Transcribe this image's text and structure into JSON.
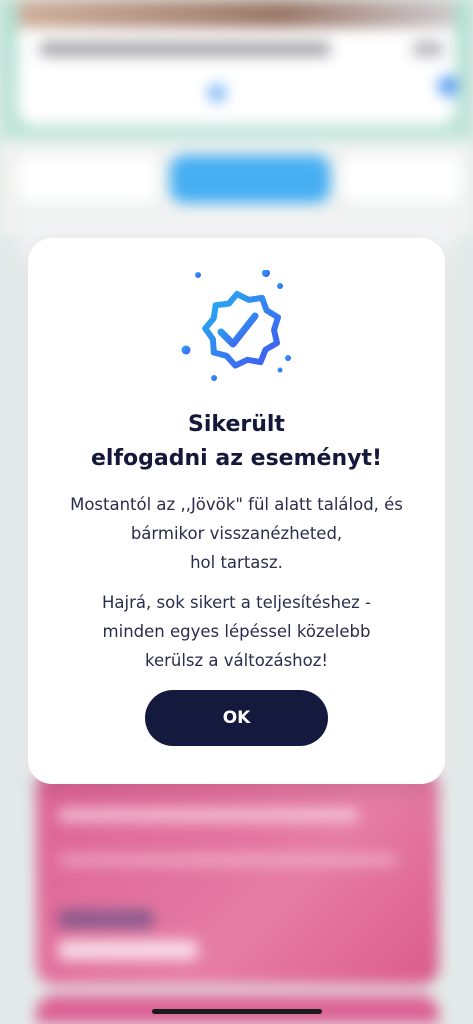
{
  "modal": {
    "icon": "verified-check-badge-icon",
    "title_line1": "Sikerült",
    "title_line2": "elfogadni az eseményt!",
    "body1_line1": "Mostantól az ,,Jövök\" fül alatt találod, és",
    "body1_line2": "bármikor visszanézheted,",
    "body1_line3": "hol tartasz.",
    "body2_line1": "Hajrá, sok sikert a teljesítéshez -",
    "body2_line2": "minden egyes lépéssel közelebb",
    "body2_line3": "kerülsz a változáshoz!",
    "ok_label": "OK"
  },
  "colors": {
    "accent_start": "#28a8f0",
    "accent_end": "#3f5cf0",
    "button_bg": "#141a3d",
    "title_text": "#15183a"
  }
}
